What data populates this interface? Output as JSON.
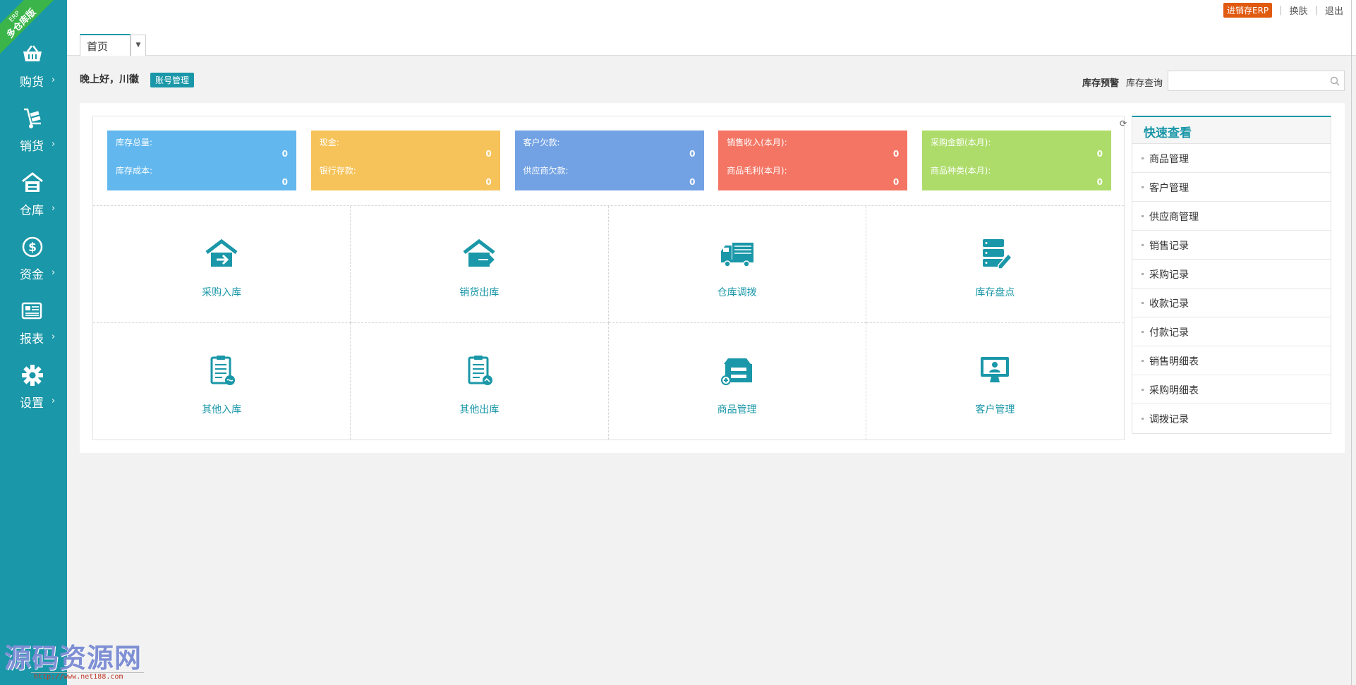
{
  "sidebar": {
    "ribbon": {
      "line1": "ERP",
      "line2": "多仓库版"
    },
    "items": [
      {
        "label": "购货",
        "icon": "basket-icon"
      },
      {
        "label": "销货",
        "icon": "hand-truck-icon"
      },
      {
        "label": "仓库",
        "icon": "warehouse-icon"
      },
      {
        "label": "资金",
        "icon": "dollar-icon"
      },
      {
        "label": "报表",
        "icon": "report-icon"
      },
      {
        "label": "设置",
        "icon": "gear-icon"
      }
    ],
    "watermark": {
      "main": "源码资源网",
      "url": "http://www.net188.com"
    }
  },
  "topbar": {
    "erp_badge": "进销存ERP",
    "skin": "换肤",
    "logout": "退出",
    "tab": "首页"
  },
  "greeting": {
    "text": "晚上好，川徽",
    "account_button": "账号管理"
  },
  "stock": {
    "warning": "库存预警",
    "query": "库存查询",
    "search_placeholder": ""
  },
  "colors": {
    "sidebar": "#1a97a8",
    "accent": "#1a97a8",
    "stat_blue": "#62b7ee",
    "stat_yellow": "#f6c35a",
    "stat_indigo": "#72a2e4",
    "stat_red": "#f47564",
    "stat_green": "#addc6a",
    "erp_badge": "#e05a10"
  },
  "stats": [
    {
      "label1": "库存总量:",
      "value1": "0",
      "label2": "库存成本:",
      "value2": "0",
      "color": "#62b7ee"
    },
    {
      "label1": "现金:",
      "value1": "0",
      "label2": "银行存款:",
      "value2": "0",
      "color": "#f6c35a"
    },
    {
      "label1": "客户欠款:",
      "value1": "0",
      "label2": "供应商欠款:",
      "value2": "0",
      "color": "#72a2e4"
    },
    {
      "label1": "销售收入(本月):",
      "value1": "0",
      "label2": "商品毛利(本月):",
      "value2": "0",
      "color": "#f47564"
    },
    {
      "label1": "采购金额(本月):",
      "value1": "0",
      "label2": "商品种类(本月):",
      "value2": "0",
      "color": "#addc6a"
    }
  ],
  "shortcuts": [
    {
      "label": "采购入库",
      "icon": "house-in-icon"
    },
    {
      "label": "销货出库",
      "icon": "house-out-icon"
    },
    {
      "label": "仓库调拨",
      "icon": "truck-icon"
    },
    {
      "label": "库存盘点",
      "icon": "inventory-check-icon"
    },
    {
      "label": "其他入库",
      "icon": "clipboard-in-icon"
    },
    {
      "label": "其他出库",
      "icon": "clipboard-out-icon"
    },
    {
      "label": "商品管理",
      "icon": "product-box-icon"
    },
    {
      "label": "客户管理",
      "icon": "customer-monitor-icon"
    }
  ],
  "quick_view": {
    "title": "快速查看",
    "items": [
      "商品管理",
      "客户管理",
      "供应商管理",
      "销售记录",
      "采购记录",
      "收款记录",
      "付款记录",
      "销售明细表",
      "采购明细表",
      "调拨记录"
    ]
  }
}
